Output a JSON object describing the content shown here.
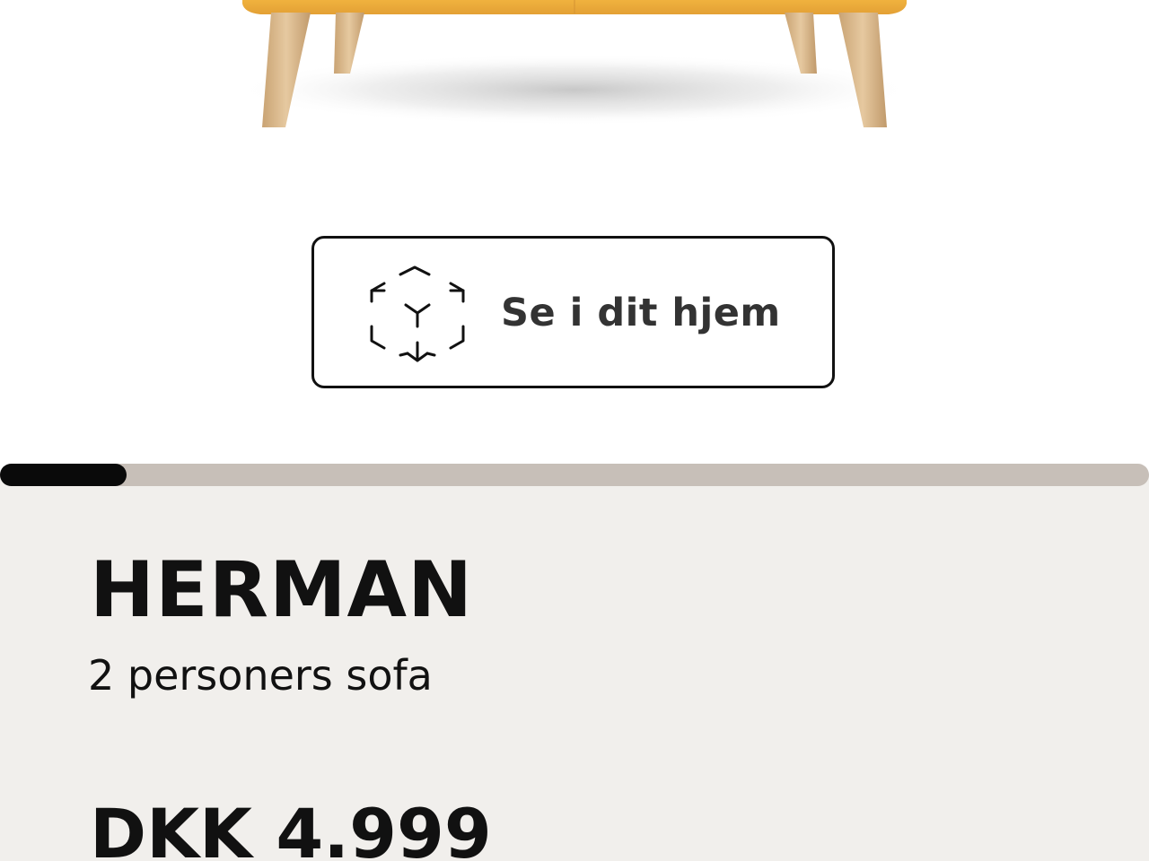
{
  "gallery": {
    "image_alt": "HERMAN sofa",
    "slide_progress": 0.11
  },
  "ar_button": {
    "label": "Se i dit hjem",
    "icon": "ar-cube-icon"
  },
  "product": {
    "name": "HERMAN",
    "description": "2 personers sofa",
    "price": "DKK 4.999"
  },
  "colors": {
    "sofa_upholstery": "#e8a83a",
    "legs_wood": "#d8b68a",
    "panel_background": "#f1efec",
    "progress_track": "#c7bfb8",
    "progress_fill": "#0a0a0a"
  }
}
